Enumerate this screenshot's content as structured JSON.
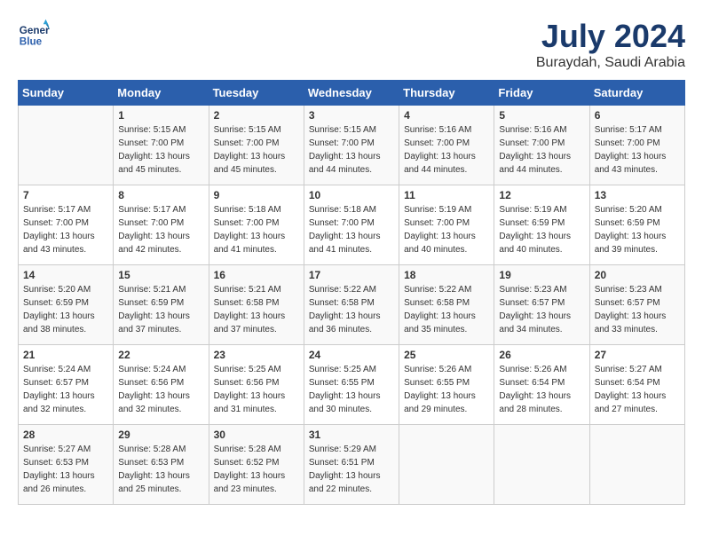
{
  "header": {
    "logo_line1": "General",
    "logo_line2": "Blue",
    "month": "July 2024",
    "location": "Buraydah, Saudi Arabia"
  },
  "weekdays": [
    "Sunday",
    "Monday",
    "Tuesday",
    "Wednesday",
    "Thursday",
    "Friday",
    "Saturday"
  ],
  "weeks": [
    [
      {
        "day": "",
        "info": ""
      },
      {
        "day": "1",
        "info": "Sunrise: 5:15 AM\nSunset: 7:00 PM\nDaylight: 13 hours\nand 45 minutes."
      },
      {
        "day": "2",
        "info": "Sunrise: 5:15 AM\nSunset: 7:00 PM\nDaylight: 13 hours\nand 45 minutes."
      },
      {
        "day": "3",
        "info": "Sunrise: 5:15 AM\nSunset: 7:00 PM\nDaylight: 13 hours\nand 44 minutes."
      },
      {
        "day": "4",
        "info": "Sunrise: 5:16 AM\nSunset: 7:00 PM\nDaylight: 13 hours\nand 44 minutes."
      },
      {
        "day": "5",
        "info": "Sunrise: 5:16 AM\nSunset: 7:00 PM\nDaylight: 13 hours\nand 44 minutes."
      },
      {
        "day": "6",
        "info": "Sunrise: 5:17 AM\nSunset: 7:00 PM\nDaylight: 13 hours\nand 43 minutes."
      }
    ],
    [
      {
        "day": "7",
        "info": "Sunrise: 5:17 AM\nSunset: 7:00 PM\nDaylight: 13 hours\nand 43 minutes."
      },
      {
        "day": "8",
        "info": "Sunrise: 5:17 AM\nSunset: 7:00 PM\nDaylight: 13 hours\nand 42 minutes."
      },
      {
        "day": "9",
        "info": "Sunrise: 5:18 AM\nSunset: 7:00 PM\nDaylight: 13 hours\nand 41 minutes."
      },
      {
        "day": "10",
        "info": "Sunrise: 5:18 AM\nSunset: 7:00 PM\nDaylight: 13 hours\nand 41 minutes."
      },
      {
        "day": "11",
        "info": "Sunrise: 5:19 AM\nSunset: 7:00 PM\nDaylight: 13 hours\nand 40 minutes."
      },
      {
        "day": "12",
        "info": "Sunrise: 5:19 AM\nSunset: 6:59 PM\nDaylight: 13 hours\nand 40 minutes."
      },
      {
        "day": "13",
        "info": "Sunrise: 5:20 AM\nSunset: 6:59 PM\nDaylight: 13 hours\nand 39 minutes."
      }
    ],
    [
      {
        "day": "14",
        "info": "Sunrise: 5:20 AM\nSunset: 6:59 PM\nDaylight: 13 hours\nand 38 minutes."
      },
      {
        "day": "15",
        "info": "Sunrise: 5:21 AM\nSunset: 6:59 PM\nDaylight: 13 hours\nand 37 minutes."
      },
      {
        "day": "16",
        "info": "Sunrise: 5:21 AM\nSunset: 6:58 PM\nDaylight: 13 hours\nand 37 minutes."
      },
      {
        "day": "17",
        "info": "Sunrise: 5:22 AM\nSunset: 6:58 PM\nDaylight: 13 hours\nand 36 minutes."
      },
      {
        "day": "18",
        "info": "Sunrise: 5:22 AM\nSunset: 6:58 PM\nDaylight: 13 hours\nand 35 minutes."
      },
      {
        "day": "19",
        "info": "Sunrise: 5:23 AM\nSunset: 6:57 PM\nDaylight: 13 hours\nand 34 minutes."
      },
      {
        "day": "20",
        "info": "Sunrise: 5:23 AM\nSunset: 6:57 PM\nDaylight: 13 hours\nand 33 minutes."
      }
    ],
    [
      {
        "day": "21",
        "info": "Sunrise: 5:24 AM\nSunset: 6:57 PM\nDaylight: 13 hours\nand 32 minutes."
      },
      {
        "day": "22",
        "info": "Sunrise: 5:24 AM\nSunset: 6:56 PM\nDaylight: 13 hours\nand 32 minutes."
      },
      {
        "day": "23",
        "info": "Sunrise: 5:25 AM\nSunset: 6:56 PM\nDaylight: 13 hours\nand 31 minutes."
      },
      {
        "day": "24",
        "info": "Sunrise: 5:25 AM\nSunset: 6:55 PM\nDaylight: 13 hours\nand 30 minutes."
      },
      {
        "day": "25",
        "info": "Sunrise: 5:26 AM\nSunset: 6:55 PM\nDaylight: 13 hours\nand 29 minutes."
      },
      {
        "day": "26",
        "info": "Sunrise: 5:26 AM\nSunset: 6:54 PM\nDaylight: 13 hours\nand 28 minutes."
      },
      {
        "day": "27",
        "info": "Sunrise: 5:27 AM\nSunset: 6:54 PM\nDaylight: 13 hours\nand 27 minutes."
      }
    ],
    [
      {
        "day": "28",
        "info": "Sunrise: 5:27 AM\nSunset: 6:53 PM\nDaylight: 13 hours\nand 26 minutes."
      },
      {
        "day": "29",
        "info": "Sunrise: 5:28 AM\nSunset: 6:53 PM\nDaylight: 13 hours\nand 25 minutes."
      },
      {
        "day": "30",
        "info": "Sunrise: 5:28 AM\nSunset: 6:52 PM\nDaylight: 13 hours\nand 23 minutes."
      },
      {
        "day": "31",
        "info": "Sunrise: 5:29 AM\nSunset: 6:51 PM\nDaylight: 13 hours\nand 22 minutes."
      },
      {
        "day": "",
        "info": ""
      },
      {
        "day": "",
        "info": ""
      },
      {
        "day": "",
        "info": ""
      }
    ]
  ]
}
